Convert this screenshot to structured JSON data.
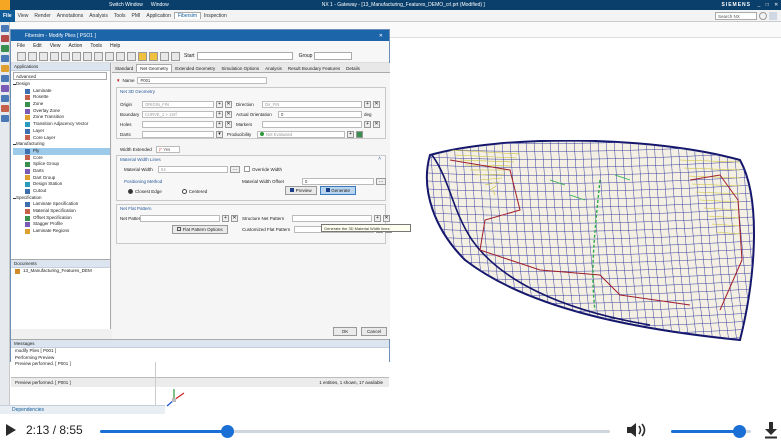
{
  "topbar": {
    "title": "NX 1 - Gateway - [13_Manufacturing_Features_DEMO_crl.prt (Modified) ]",
    "switch_window": "Switch Window",
    "window": "Window",
    "brand": "SIEMENS"
  },
  "menubar": {
    "file": "File",
    "tabs": [
      "View",
      "Render",
      "Annotations",
      "Analysis",
      "Tools",
      "PMI",
      "Application",
      "Fibersim",
      "Inspection"
    ],
    "active_tab": "Fibersim",
    "search_placeholder": "Search NX commands"
  },
  "dialog": {
    "title": "Fibersim - Modify Plies [ PSO1 ]",
    "menu": [
      "File",
      "Edit",
      "View",
      "Action",
      "Tools",
      "Help"
    ],
    "start_label": "Start",
    "group_label": "Group",
    "applications_header": "Applications",
    "mode_select": "Advanced",
    "tree": {
      "design": "Design",
      "design_items": [
        "Laminate",
        "Rosette",
        "Zone",
        "Overlay Zone",
        "Zone Transition",
        "Transition Adjacency Vector",
        "Layer",
        "Core Layer"
      ],
      "manufacturing": "Manufacturing",
      "manufacturing_items": [
        "Ply",
        "Core",
        "Splice Group",
        "Darts",
        "Dart Group",
        "Design Station",
        "Cutout"
      ],
      "specification": "Specification",
      "specification_items": [
        "Laminate Specification",
        "Material Specification",
        "Offset Specification",
        "Stagger Profile",
        "Laminate Regions"
      ],
      "selected": "Ply"
    },
    "documents_header": "Documents",
    "documents_item": "13_Manufacturing_Features_DEM",
    "subtabs": [
      "Standard",
      "Net Geometry",
      "Extended Geometry",
      "Simulation Options",
      "Analysis",
      "Result Boundary Features",
      "Details"
    ],
    "active_subtab": "Net Geometry",
    "name_label": "Name",
    "name_value": "P001",
    "net3d_header": "Net 3D Geometry",
    "origin_label": "Origin",
    "origin_value": "ORIGIN_FIN",
    "direction_label": "Direction",
    "direction_value": "Dir_FIN",
    "boundary_label": "Boundary",
    "boundary_value": "CURVE_1 > 1Srf",
    "actual_orientation_label": "Actual Orientation",
    "actual_orientation_value": "0",
    "actual_orientation_unit": "deg",
    "holes_label": "Holes",
    "markers_label": "Markers",
    "darts_label": "Darts",
    "producibility_label": "Producibility",
    "producibility_value": "Not Evaluated",
    "width_extended_label": "Width Extended",
    "width_extended_value": "Yes",
    "material_width_lines_header": "Material Width Lines",
    "material_width_label": "Material Width",
    "material_width_value": "54",
    "override_width_label": "Override Width",
    "positioning_method_label": "Positioning Method",
    "closest_edge_label": "Closest Edge",
    "centered_label": "Centered",
    "material_width_offset_label": "Material Width Offset",
    "material_width_offset_value": "0",
    "preview_label": "Preview",
    "generate_label": "Generate",
    "net_flat_pattern_header": "Net Flat Pattern",
    "net_pattern_label": "Net Pattern",
    "structure_net_pattern_label": "Structure Net Pattern",
    "flat_pattern_options_label": "Flat Pattern Options",
    "customized_flat_pattern_label": "Customized Flat Pattern",
    "ok_label": "OK",
    "cancel_label": "Cancel",
    "messages_header": "Messages",
    "messages": [
      "modify Plies [ P001 ]",
      "Performing Preview",
      "Preview performed. [ P001 ]"
    ],
    "status_left": "Preview performed. [ P001 ]",
    "status_right": "1 entities, 1 shown, 17 available"
  },
  "tooltip": "Generate the 3D Material Width lines",
  "dependencies_label": "Dependencies",
  "player": {
    "time": "2:13 / 8:55",
    "progress": 0.249,
    "volume": 0.85
  },
  "colors": {
    "nx_blue": "#0a3f6b",
    "dialog_blue": "#1c65a8",
    "player_blue": "#1a6fd6"
  }
}
